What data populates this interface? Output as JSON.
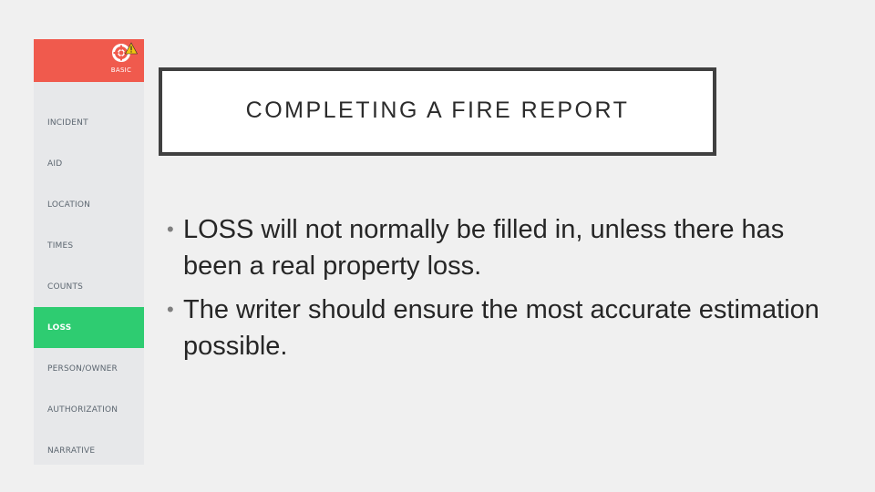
{
  "sidebar": {
    "header_label": "BASIC",
    "items": [
      {
        "label": "INCIDENT"
      },
      {
        "label": "AID"
      },
      {
        "label": "LOCATION"
      },
      {
        "label": "TIMES"
      },
      {
        "label": "COUNTS"
      },
      {
        "label": "LOSS",
        "active": true
      },
      {
        "label": "PERSON/OWNER"
      },
      {
        "label": "AUTHORIZATION"
      },
      {
        "label": "NARRATIVE"
      }
    ]
  },
  "slide": {
    "title": "COMPLETING A FIRE REPORT",
    "bullets": [
      "LOSS will not normally be filled in, unless there has been a real property loss.",
      "The writer should ensure the most accurate estimation possible."
    ],
    "bullet_glyph": "•"
  },
  "colors": {
    "background": "#f0f0f0",
    "sidebar_background": "#e7e8ea",
    "header_red": "#f05a4d",
    "active_green": "#2ecc71",
    "warning_yellow": "#f1c40f",
    "title_border": "#404040"
  },
  "icons": {
    "header": "lifebuoy-warning-icon"
  }
}
